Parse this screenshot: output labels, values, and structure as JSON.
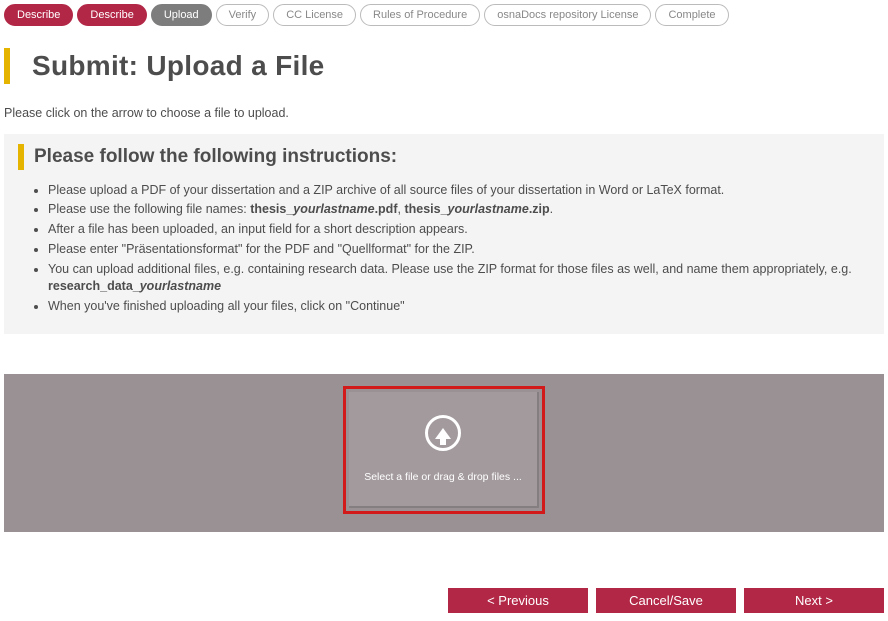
{
  "progress": {
    "steps": [
      {
        "label": "Describe",
        "state": "done"
      },
      {
        "label": "Describe",
        "state": "done"
      },
      {
        "label": "Upload",
        "state": "current"
      },
      {
        "label": "Verify",
        "state": "pending"
      },
      {
        "label": "CC License",
        "state": "pending"
      },
      {
        "label": "Rules of Procedure",
        "state": "pending"
      },
      {
        "label": "osnaDocs repository License",
        "state": "pending"
      },
      {
        "label": "Complete",
        "state": "pending"
      }
    ]
  },
  "header": {
    "title": "Submit: Upload a File"
  },
  "intro_text": "Please click on the arrow to choose a file to upload.",
  "instructions": {
    "title": "Please follow the following instructions:",
    "items": {
      "i1_pre": "Please upload a PDF of your dissertation and a ZIP archive of all source files of your dissertation in Word or LaTeX format.",
      "i2_pre": "Please use the following file names: ",
      "i2_b1a": "thesis_",
      "i2_b1b": "yourlastname",
      "i2_b1c": ".pdf",
      "i2_mid": ", ",
      "i2_b2a": "thesis_",
      "i2_b2b": "yourlastname",
      "i2_b2c": ".zip",
      "i2_post": ".",
      "i3": "After a file has been uploaded, an input field for a short description appears.",
      "i4": "Please enter \"Präsentationsformat\" for the PDF and \"Quellformat\" for the ZIP.",
      "i5_pre": "You can upload additional files, e.g. containing research data. Please use the ZIP format for those files as well, and name them appropriately, e.g. ",
      "i5_b1a": "research_data_",
      "i5_b1b": "yourlastname",
      "i6": "When you've finished uploading all your files, click on \"Continue\""
    }
  },
  "upload": {
    "prompt": "Select a file or drag & drop files ..."
  },
  "buttons": {
    "previous": "< Previous",
    "cancel": "Cancel/Save",
    "next": "Next >"
  }
}
